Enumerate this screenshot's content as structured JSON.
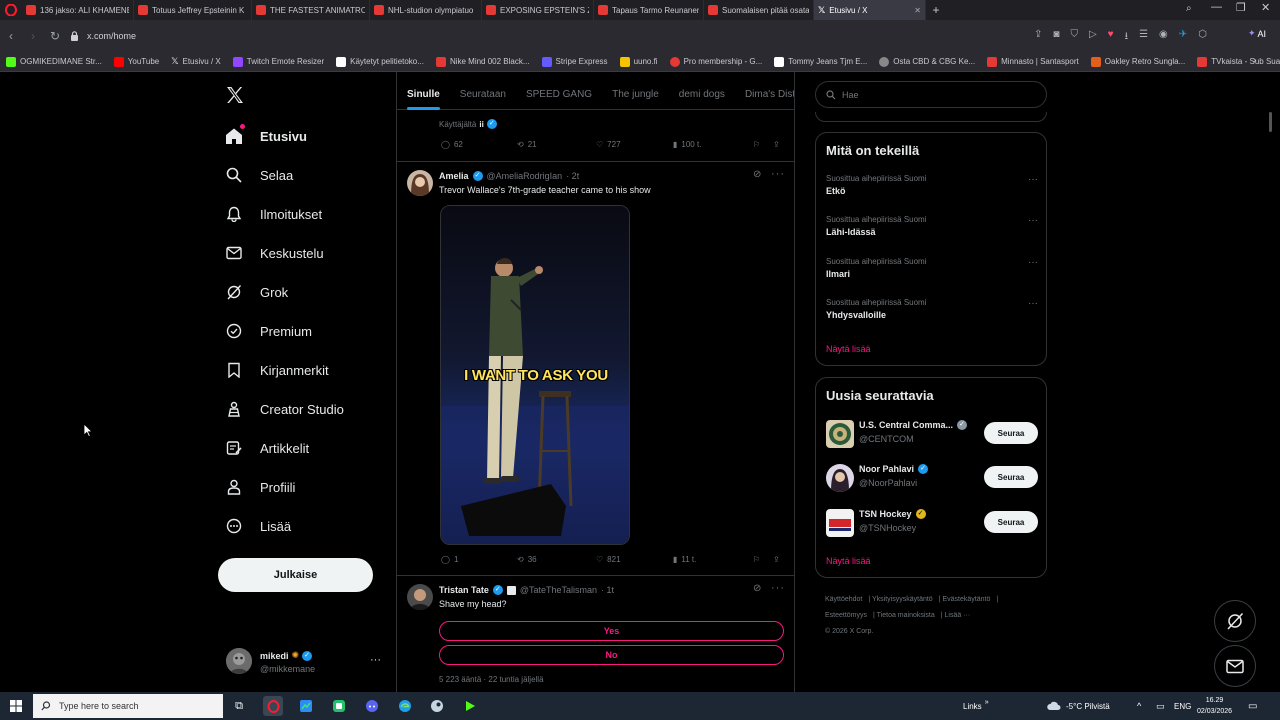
{
  "browser": {
    "tabs": [
      {
        "label": "136 jakso: ALI KHAMENEI",
        "color": "#e53935"
      },
      {
        "label": "Totuus Jeffrey Epsteinin K",
        "color": "#e53935"
      },
      {
        "label": "THE FASTEST ANIMATRON",
        "color": "#e53935"
      },
      {
        "label": "NHL-studion olympiatuo",
        "color": "#e53935"
      },
      {
        "label": "EXPOSING EPSTEIN'S ZOR",
        "color": "#e53935"
      },
      {
        "label": "Tapaus Tarmo Reunanen j",
        "color": "#e53935"
      },
      {
        "label": "Suomalaisen pitää osata p",
        "color": "#e53935"
      },
      {
        "label": "Etusivu / X",
        "color": "#ffffff"
      }
    ],
    "url": "x.com/home",
    "ai_label": "AI",
    "bookmarks": [
      {
        "label": "OGMIKEDIMANE Str...",
        "color": "#53fc18"
      },
      {
        "label": "YouTube",
        "color": "#ff0000"
      },
      {
        "label": "Etusivu / X",
        "color": "#ffffff"
      },
      {
        "label": "Twitch Emote Resizer",
        "color": "#9146ff"
      },
      {
        "label": "Käytetyt pelitietoko...",
        "color": "#ffffff"
      },
      {
        "label": "Nike Mind 002 Black...",
        "color": "#e53935"
      },
      {
        "label": "Stripe Express",
        "color": "#635bff"
      },
      {
        "label": "uuno.fi",
        "color": "#f5c400"
      },
      {
        "label": "Pro membership - G...",
        "color": "#e53935"
      },
      {
        "label": "Tommy Jeans Tjm E...",
        "color": "#ffffff"
      },
      {
        "label": "Osta CBD & CBG Ke...",
        "color": "#888888"
      },
      {
        "label": "Minnasto | Santasport",
        "color": "#e53935"
      },
      {
        "label": "Oakley Retro Sungla...",
        "color": "#e2601c"
      },
      {
        "label": "TVkaista - Sub Suara",
        "color": "#e53935"
      }
    ]
  },
  "sidebar": {
    "items": [
      {
        "label": "Etusivu",
        "icon": "home-icon"
      },
      {
        "label": "Selaa",
        "icon": "search-icon"
      },
      {
        "label": "Ilmoitukset",
        "icon": "bell-icon"
      },
      {
        "label": "Keskustelu",
        "icon": "mail-icon"
      },
      {
        "label": "Grok",
        "icon": "grok-icon"
      },
      {
        "label": "Premium",
        "icon": "premium-icon"
      },
      {
        "label": "Kirjanmerkit",
        "icon": "bookmark-icon"
      },
      {
        "label": "Creator Studio",
        "icon": "creator-icon"
      },
      {
        "label": "Artikkelit",
        "icon": "articles-icon"
      },
      {
        "label": "Profiili",
        "icon": "profile-icon"
      },
      {
        "label": "Lisää",
        "icon": "more-icon"
      }
    ],
    "post_label": "Julkaise",
    "user": {
      "name": "mikedi",
      "handle": "@mikkemane"
    }
  },
  "feed": {
    "tabs": [
      "Sinulle",
      "Seurataan",
      "SPEED GANG",
      "The jungle",
      "demi dogs",
      "Dima's Dist"
    ],
    "top_post": {
      "context": "Käyttäjältä",
      "context_name": "ii",
      "replies": "62",
      "reposts": "21",
      "likes": "727",
      "views": "100 t."
    },
    "post1": {
      "name": "Amelia",
      "handle": "@AmeliaRodrigIan",
      "time": "· 2t",
      "text": "Trevor Wallace's 7th-grade teacher came to his show",
      "video_caption": "I WANT TO ASK YOU",
      "replies": "1",
      "reposts": "36",
      "likes": "821",
      "views": "11 t."
    },
    "post2": {
      "name": "Tristan Tate",
      "handle": "@TateTheTalisman",
      "time": "· 1t",
      "text": "Shave my head?",
      "poll_options": [
        "Yes",
        "No"
      ],
      "poll_meta": "5 223 ääntä · 22 tuntia jäljellä"
    }
  },
  "right": {
    "search_placeholder": "Hae",
    "trending": {
      "title": "Mitä on tekeillä",
      "items": [
        {
          "context": "Suosittua aihepiirissä Suomi",
          "name": "Etkö"
        },
        {
          "context": "Suosittua aihepiirissä Suomi",
          "name": "Lähi-Idässä"
        },
        {
          "context": "Suosittua aihepiirissä Suomi",
          "name": "Ilmari"
        },
        {
          "context": "Suosittua aihepiirissä Suomi",
          "name": "Yhdysvalloille"
        }
      ],
      "show_more": "Näytä lisää"
    },
    "who_to_follow": {
      "title": "Uusia seurattavia",
      "items": [
        {
          "name": "U.S. Central Comma...",
          "handle": "@CENTCOM",
          "button": "Seuraa"
        },
        {
          "name": "Noor Pahlavi",
          "handle": "@NoorPahlavi",
          "button": "Seuraa"
        },
        {
          "name": "TSN Hockey",
          "handle": "@TSNHockey",
          "button": "Seuraa"
        }
      ],
      "show_more": "Näytä lisää"
    },
    "footer": [
      "Käyttöehdot",
      "Yksityisyyskäytäntö",
      "Evästekäytäntö",
      "Esteettömyys",
      "Tietoa mainoksista",
      "Lisää ···",
      "© 2026 X Corp."
    ]
  },
  "taskbar": {
    "search_placeholder": "Type here to search",
    "links_label": "Links",
    "weather": "-5°C  Pilvistä",
    "lang": "ENG",
    "time": "16.29",
    "date": "02/03/2026"
  },
  "colors": {
    "accent": "#1d9bf0",
    "pink": "#f91880",
    "background": "#000000"
  }
}
